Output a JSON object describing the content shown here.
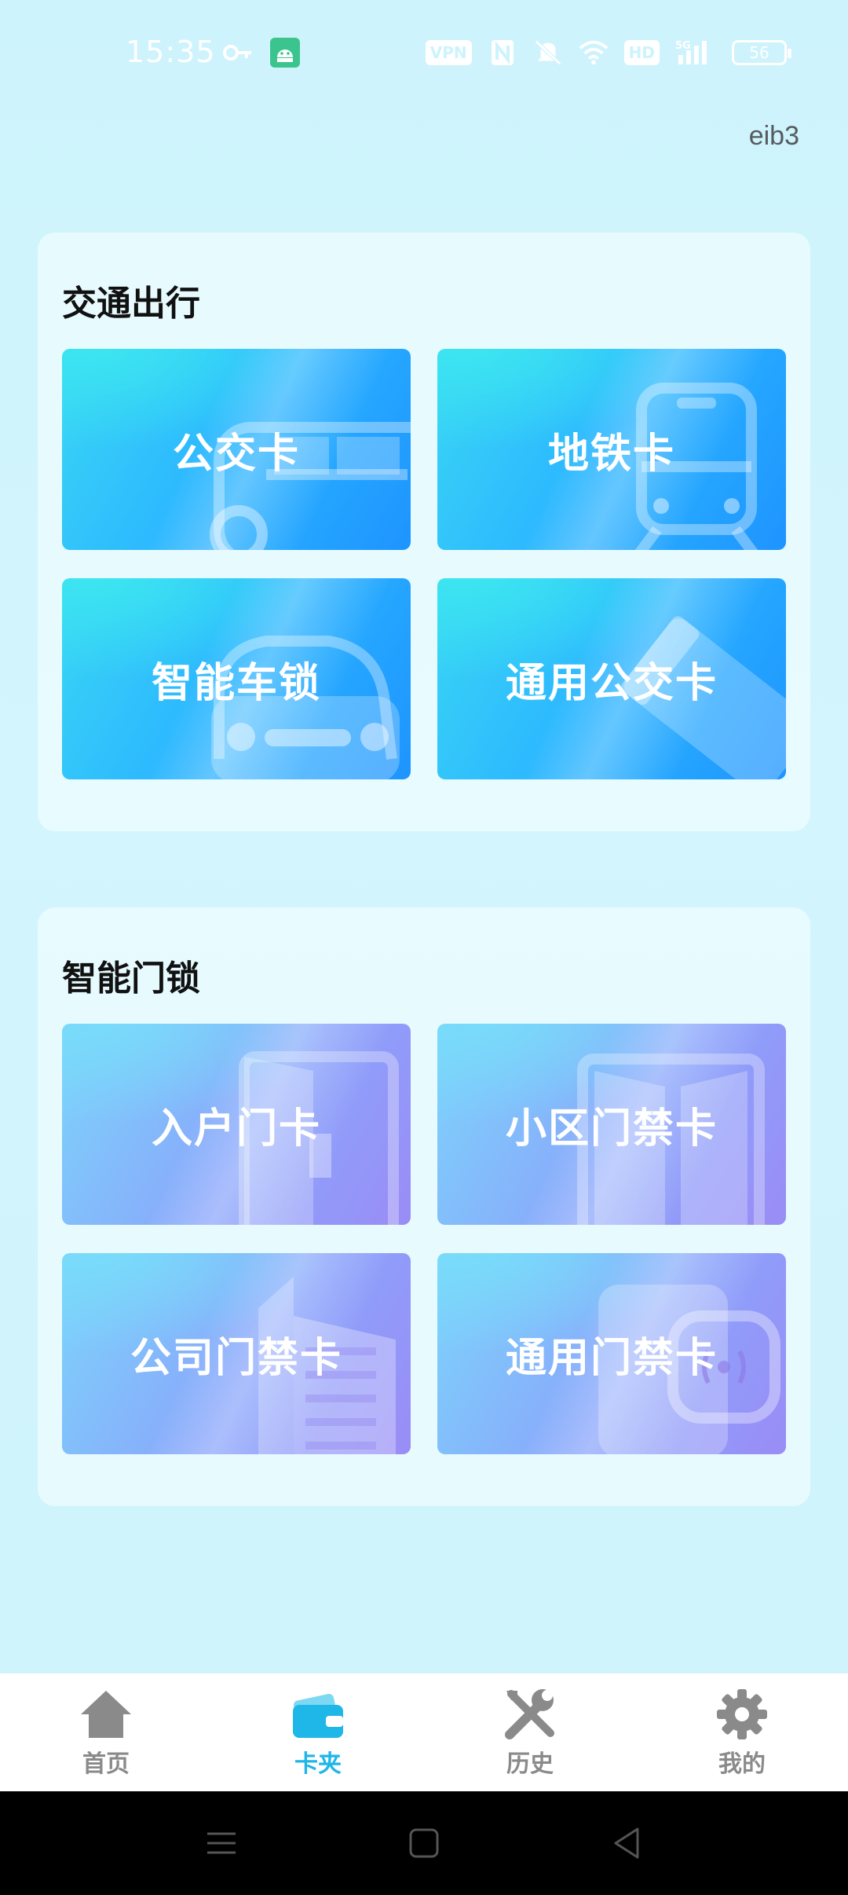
{
  "status_bar": {
    "time": "15:35",
    "vpn_label": "VPN",
    "hd_label": "HD",
    "network_label": "5G",
    "battery_level": "56",
    "icons": [
      "key-icon",
      "android-icon",
      "nfc-icon",
      "mute-icon",
      "wifi-icon",
      "signal-icon",
      "battery-icon"
    ]
  },
  "header": {
    "user_id": "eib3"
  },
  "sections": [
    {
      "title": "交通出行",
      "cards": [
        {
          "label": "公交卡",
          "icon": "bus-icon",
          "theme": "blue"
        },
        {
          "label": "地铁卡",
          "icon": "train-icon",
          "theme": "blue"
        },
        {
          "label": "智能车锁",
          "icon": "car-icon",
          "theme": "blue"
        },
        {
          "label": "通用公交卡",
          "icon": "card-icon",
          "theme": "blue"
        }
      ]
    },
    {
      "title": "智能门锁",
      "cards": [
        {
          "label": "入户门卡",
          "icon": "door-icon",
          "theme": "purple"
        },
        {
          "label": "小区门禁卡",
          "icon": "gate-icon",
          "theme": "purple"
        },
        {
          "label": "公司门禁卡",
          "icon": "building-icon",
          "theme": "purple"
        },
        {
          "label": "通用门禁卡",
          "icon": "nfc-reader-icon",
          "theme": "purple"
        }
      ]
    }
  ],
  "bottom_nav": {
    "items": [
      {
        "label": "首页",
        "icon": "home-icon",
        "active": false
      },
      {
        "label": "卡夹",
        "icon": "wallet-icon",
        "active": true
      },
      {
        "label": "历史",
        "icon": "tools-icon",
        "active": false
      },
      {
        "label": "我的",
        "icon": "gear-icon",
        "active": false
      }
    ]
  },
  "colors": {
    "background": "#cdf3fc",
    "active_tab": "#1fb6e8",
    "inactive_tab": "#8a8a8a",
    "card_blue": "#2cb8ff",
    "card_purple": "#8aa6fb"
  }
}
